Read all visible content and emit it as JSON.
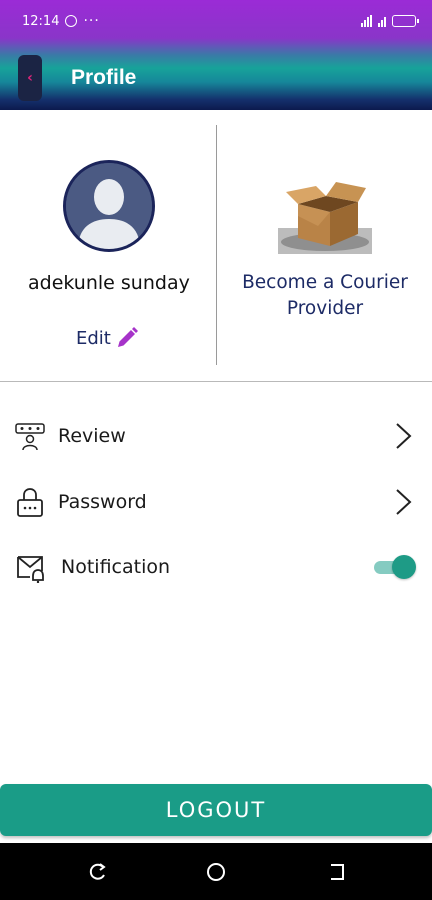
{
  "status_bar": {
    "time": "12:14",
    "more": "···"
  },
  "app_bar": {
    "title": "Profile",
    "back_glyph": "‹"
  },
  "profile": {
    "name": "adekunle sunday",
    "edit_label": "Edit"
  },
  "courier": {
    "label": "Become a Courier Provider",
    "image_icon": "open-box-icon"
  },
  "menu": {
    "items": [
      {
        "label": "Review",
        "icon": "review-icon",
        "action": "chevron"
      },
      {
        "label": "Password",
        "icon": "lock-icon",
        "action": "chevron"
      },
      {
        "label": "Notification",
        "icon": "mail-bell-icon",
        "action": "toggle",
        "enabled": true
      }
    ]
  },
  "logout": {
    "label": "LOGOUT"
  },
  "colors": {
    "accent_teal": "#1a9c87",
    "navy_text": "#1d2b66",
    "edit_pencil": "#a633c9"
  }
}
